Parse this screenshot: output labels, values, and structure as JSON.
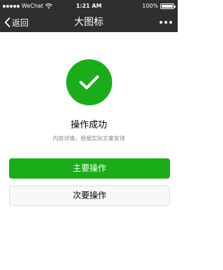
{
  "status_bar": {
    "carrier": "WeChat",
    "time": "1:21 AM",
    "battery": "100%",
    "battery_level": 1.0
  },
  "nav": {
    "back_label": "返回",
    "title": "大图标",
    "more_icon": "more-icon"
  },
  "message": {
    "icon": "success-check-icon",
    "title": "操作成功",
    "description": "内容详情，根据实际文案安排"
  },
  "actions": {
    "primary_label": "主要操作",
    "secondary_label": "次要操作"
  },
  "colors": {
    "brand_green": "#1aad19",
    "nav_background": "#2f2f2f",
    "secondary_button_bg": "#f8f8f8",
    "secondary_button_border": "#dcdcdc",
    "desc_text": "#888888"
  }
}
